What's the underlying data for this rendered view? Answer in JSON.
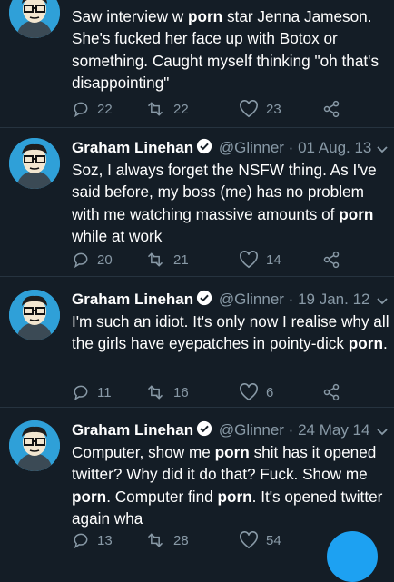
{
  "colors": {
    "background": "#141d26",
    "muted": "#8899a6",
    "accent": "#1da1f2",
    "divider": "#26333f"
  },
  "tweets": [
    {
      "name": "",
      "handle": "",
      "date": "",
      "text_parts": [
        "Saw interview w ",
        "porn",
        " star Jenna Jameson. She's fucked her face up with Botox or something. Caught myself thinking \"oh that's disappointing\""
      ],
      "replies": "22",
      "retweets": "22",
      "likes": "23"
    },
    {
      "name": "Graham Linehan",
      "handle": "@Glinner",
      "date": "01 Aug. 13",
      "text_parts": [
        "Soz, I always forget the NSFW thing. As I've said before, my boss (me) has no problem with me watching massive amounts of ",
        "porn",
        " while at work"
      ],
      "replies": "20",
      "retweets": "21",
      "likes": "14"
    },
    {
      "name": "Graham Linehan",
      "handle": "@Glinner",
      "date": "19 Jan. 12",
      "text_parts": [
        "I'm such an idiot. It's only now I realise why all the girls have eyepatches in pointy-dick ",
        "porn",
        "."
      ],
      "replies": "11",
      "retweets": "16",
      "likes": "6"
    },
    {
      "name": "Graham Linehan",
      "handle": "@Glinner",
      "date": "24 May 14",
      "text_parts": [
        "Computer, show me ",
        "porn",
        " shit has it opened twitter? Why did it do that? Fuck. Show me ",
        "porn",
        ". Computer find ",
        "porn",
        ". It's opened twitter again wha"
      ],
      "replies": "13",
      "retweets": "28",
      "likes": "54"
    }
  ],
  "separator_dot": "·",
  "icons": {
    "reply": "reply-icon",
    "retweet": "retweet-icon",
    "like": "heart-icon",
    "share": "share-icon",
    "verified": "verified-badge-icon",
    "caret": "chevron-down-icon"
  }
}
